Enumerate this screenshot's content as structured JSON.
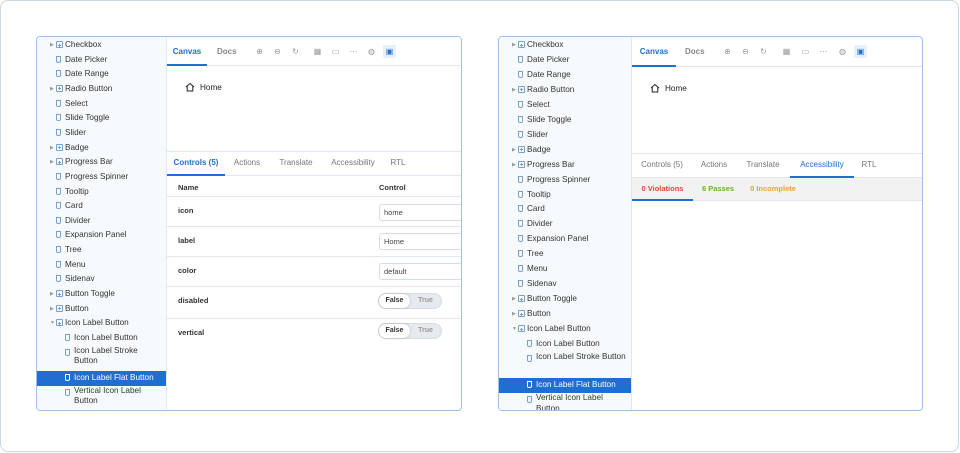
{
  "colors": {
    "accent": "#1e6fd1",
    "violations": "#e2493d",
    "passes": "#66b32e",
    "incomplete": "#e8a23a"
  },
  "icons": {
    "home": "home-icon",
    "zoom_in": "zoom-in-icon",
    "zoom_out": "zoom-out-icon",
    "reset": "zoom-reset-icon",
    "folder": "folder-icon",
    "story": "bookmark-icon"
  },
  "left": {
    "sidebar": [
      {
        "label": "Checkbox",
        "kind": "folder"
      },
      {
        "label": "Date Picker",
        "kind": "leaf"
      },
      {
        "label": "Date Range",
        "kind": "leaf"
      },
      {
        "label": "Radio Button",
        "kind": "folder"
      },
      {
        "label": "Select",
        "kind": "leaf"
      },
      {
        "label": "Slide Toggle",
        "kind": "leaf"
      },
      {
        "label": "Slider",
        "kind": "leaf"
      },
      {
        "label": "Badge",
        "kind": "folder"
      },
      {
        "label": "Progress Bar",
        "kind": "folder"
      },
      {
        "label": "Progress Spinner",
        "kind": "leaf"
      },
      {
        "label": "Tooltip",
        "kind": "leaf"
      },
      {
        "label": "Card",
        "kind": "leaf"
      },
      {
        "label": "Divider",
        "kind": "leaf"
      },
      {
        "label": "Expansion Panel",
        "kind": "leaf"
      },
      {
        "label": "Tree",
        "kind": "leaf"
      },
      {
        "label": "Menu",
        "kind": "leaf"
      },
      {
        "label": "Sidenav",
        "kind": "leaf"
      },
      {
        "label": "Button Toggle",
        "kind": "folder"
      },
      {
        "label": "Button",
        "kind": "folder"
      },
      {
        "label": "Icon Label Button",
        "kind": "folder-open"
      },
      {
        "label": "Icon Label Button",
        "kind": "sub"
      },
      {
        "label": "Icon Label Stroke Button",
        "kind": "sub-tall"
      },
      {
        "label": "Icon Label Flat Button",
        "kind": "sub-selected"
      },
      {
        "label": "Vertical Icon Label Button",
        "kind": "sub-tall"
      }
    ],
    "toolbar": {
      "canvas": "Canvas",
      "docs": "Docs"
    },
    "preview": {
      "home_label": "Home"
    },
    "addons": {
      "tabs": [
        "Controls (5)",
        "Actions",
        "Translate",
        "Accessibility",
        "RTL"
      ],
      "active": 0
    },
    "controls": {
      "col_name": "Name",
      "col_control": "Control",
      "rows": [
        {
          "name": "icon",
          "type": "text",
          "value": "home"
        },
        {
          "name": "label",
          "type": "text",
          "value": "Home"
        },
        {
          "name": "color",
          "type": "text",
          "value": "default"
        },
        {
          "name": "disabled",
          "type": "bool",
          "false_label": "False",
          "true_label": "True",
          "value": false
        },
        {
          "name": "vertical",
          "type": "bool",
          "false_label": "False",
          "true_label": "True",
          "value": false
        }
      ]
    }
  },
  "right": {
    "sidebar": [
      {
        "label": "Checkbox",
        "kind": "folder"
      },
      {
        "label": "Date Picker",
        "kind": "leaf"
      },
      {
        "label": "Date Range",
        "kind": "leaf"
      },
      {
        "label": "Radio Button",
        "kind": "folder"
      },
      {
        "label": "Select",
        "kind": "leaf"
      },
      {
        "label": "Slide Toggle",
        "kind": "leaf"
      },
      {
        "label": "Slider",
        "kind": "leaf"
      },
      {
        "label": "Badge",
        "kind": "folder"
      },
      {
        "label": "Progress Bar",
        "kind": "folder"
      },
      {
        "label": "Progress Spinner",
        "kind": "leaf"
      },
      {
        "label": "Tooltip",
        "kind": "leaf"
      },
      {
        "label": "Card",
        "kind": "leaf"
      },
      {
        "label": "Divider",
        "kind": "leaf"
      },
      {
        "label": "Expansion Panel",
        "kind": "leaf"
      },
      {
        "label": "Tree",
        "kind": "leaf"
      },
      {
        "label": "Menu",
        "kind": "leaf"
      },
      {
        "label": "Sidenav",
        "kind": "leaf"
      },
      {
        "label": "Button Toggle",
        "kind": "folder"
      },
      {
        "label": "Button",
        "kind": "folder"
      },
      {
        "label": "Icon Label Button",
        "kind": "folder-open"
      },
      {
        "label": "Icon Label Button",
        "kind": "sub"
      },
      {
        "label": "Icon Label Stroke Button",
        "kind": "sub-tall"
      },
      {
        "label": "Icon Label Flat Button",
        "kind": "sub-selected"
      },
      {
        "label": "Vertical Icon Label Button",
        "kind": "sub-tall"
      }
    ],
    "toolbar": {
      "canvas": "Canvas",
      "docs": "Docs"
    },
    "preview": {
      "home_label": "Home"
    },
    "addons": {
      "tabs": [
        "Controls (5)",
        "Actions",
        "Translate",
        "Accessibility",
        "RTL"
      ],
      "active": 3
    },
    "a11y": {
      "violations": "0 Violations",
      "passes": "6 Passes",
      "incomplete": "0 Incomplete"
    }
  }
}
